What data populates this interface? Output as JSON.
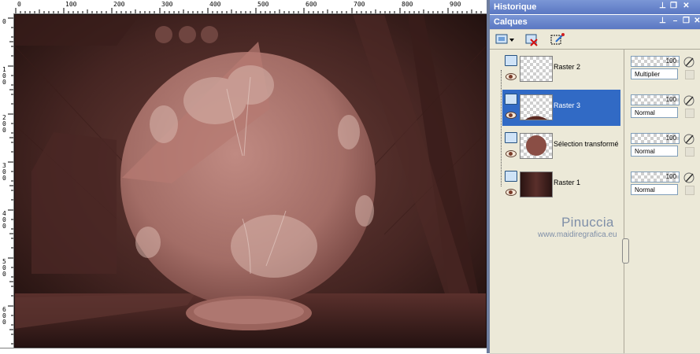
{
  "ruler": {
    "top_labels": [
      "0",
      "100",
      "200",
      "300",
      "400",
      "500",
      "600",
      "700",
      "800",
      "900"
    ],
    "left_labels": [
      "100",
      "200",
      "300",
      "400",
      "500",
      "600"
    ]
  },
  "panels": {
    "history_title": "Historique",
    "layers_title": "Calques"
  },
  "layers": [
    {
      "name": "Raster 2",
      "opacity": "100",
      "blend": "Multiplier",
      "selected": false,
      "thumb": "checker"
    },
    {
      "name": "Raster 3",
      "opacity": "100",
      "blend": "Normal",
      "selected": true,
      "thumb": "checker-arc"
    },
    {
      "name": "Sélection transformé",
      "opacity": "100",
      "blend": "Normal",
      "selected": false,
      "thumb": "circle"
    },
    {
      "name": "Raster 1",
      "opacity": "100",
      "blend": "Normal",
      "selected": false,
      "thumb": "dark"
    }
  ],
  "watermark": {
    "name": "Pinuccia",
    "url": "www.maidiregrafica.eu"
  },
  "colors": {
    "canvas_dark": "#2a1614",
    "canvas_rose": "#a8706a",
    "selection_blue": "#316ac5",
    "title_blue": "#6a86cc"
  }
}
